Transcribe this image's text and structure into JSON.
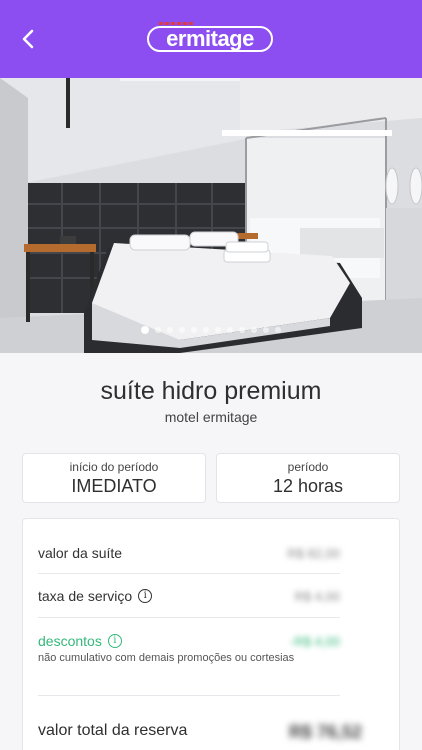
{
  "header": {
    "back_icon": "chevron-left-icon",
    "logo_text": "ermitage",
    "background_color": "#8c4ef0"
  },
  "gallery": {
    "total_slides": 12,
    "active_index": 0
  },
  "room": {
    "name": "suíte hidro premium",
    "motel": "motel ermitage"
  },
  "booking": {
    "start_label": "início do período",
    "start_value": "IMEDIATO",
    "period_label": "período",
    "period_value": "12 horas"
  },
  "summary": {
    "suite_label": "valor da suíte",
    "suite_value": "R$ 82,00",
    "fee_label": "taxa de serviço",
    "fee_value": "R$ 4,00",
    "discount_label": "descontos",
    "discount_value": "-R$ 4,00",
    "discount_note": "não cumulativo com demais promoções ou cortesias",
    "discount_color": "#35b87a",
    "total_label": "valor total da reserva",
    "total_value": "R$ 76,52"
  }
}
